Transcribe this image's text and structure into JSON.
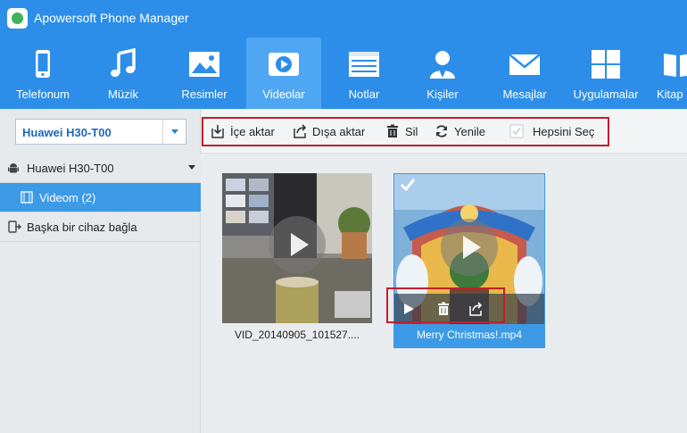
{
  "app": {
    "title": "Apowersoft Phone Manager",
    "logo_icon": "apowersoft-logo-icon"
  },
  "nav": [
    {
      "label": "Telefonum",
      "icon": "phone-icon",
      "active": false
    },
    {
      "label": "Müzik",
      "icon": "music-note-icon",
      "active": false
    },
    {
      "label": "Resimler",
      "icon": "picture-icon",
      "active": false
    },
    {
      "label": "Videolar",
      "icon": "video-play-icon",
      "active": true
    },
    {
      "label": "Notlar",
      "icon": "notes-icon",
      "active": false
    },
    {
      "label": "Kişiler",
      "icon": "contact-person-icon",
      "active": false
    },
    {
      "label": "Mesajlar",
      "icon": "envelope-icon",
      "active": false
    },
    {
      "label": "Uygulamalar",
      "icon": "apps-grid-icon",
      "active": false
    },
    {
      "label": "Kitap",
      "icon": "book-icon",
      "active": false
    }
  ],
  "device_select": {
    "value": "Huawei H30-T00"
  },
  "tree": {
    "device": "Huawei H30-T00",
    "videos": "Videom (2)",
    "connect_other": "Başka bir cihaz bağla"
  },
  "toolbar": {
    "import": "İçe aktar",
    "export": "Dışa aktar",
    "delete": "Sil",
    "refresh": "Yenile",
    "select_all": "Hepsini Seç"
  },
  "videos": [
    {
      "name": "VID_20140905_101527....",
      "selected": false
    },
    {
      "name": "Merry Christmas!.mp4",
      "selected": true
    }
  ],
  "colors": {
    "brand": "#2c8ee8",
    "active_tab": "#4fa7f3",
    "selection": "#3c9ae6",
    "highlight": "#c0202b"
  }
}
